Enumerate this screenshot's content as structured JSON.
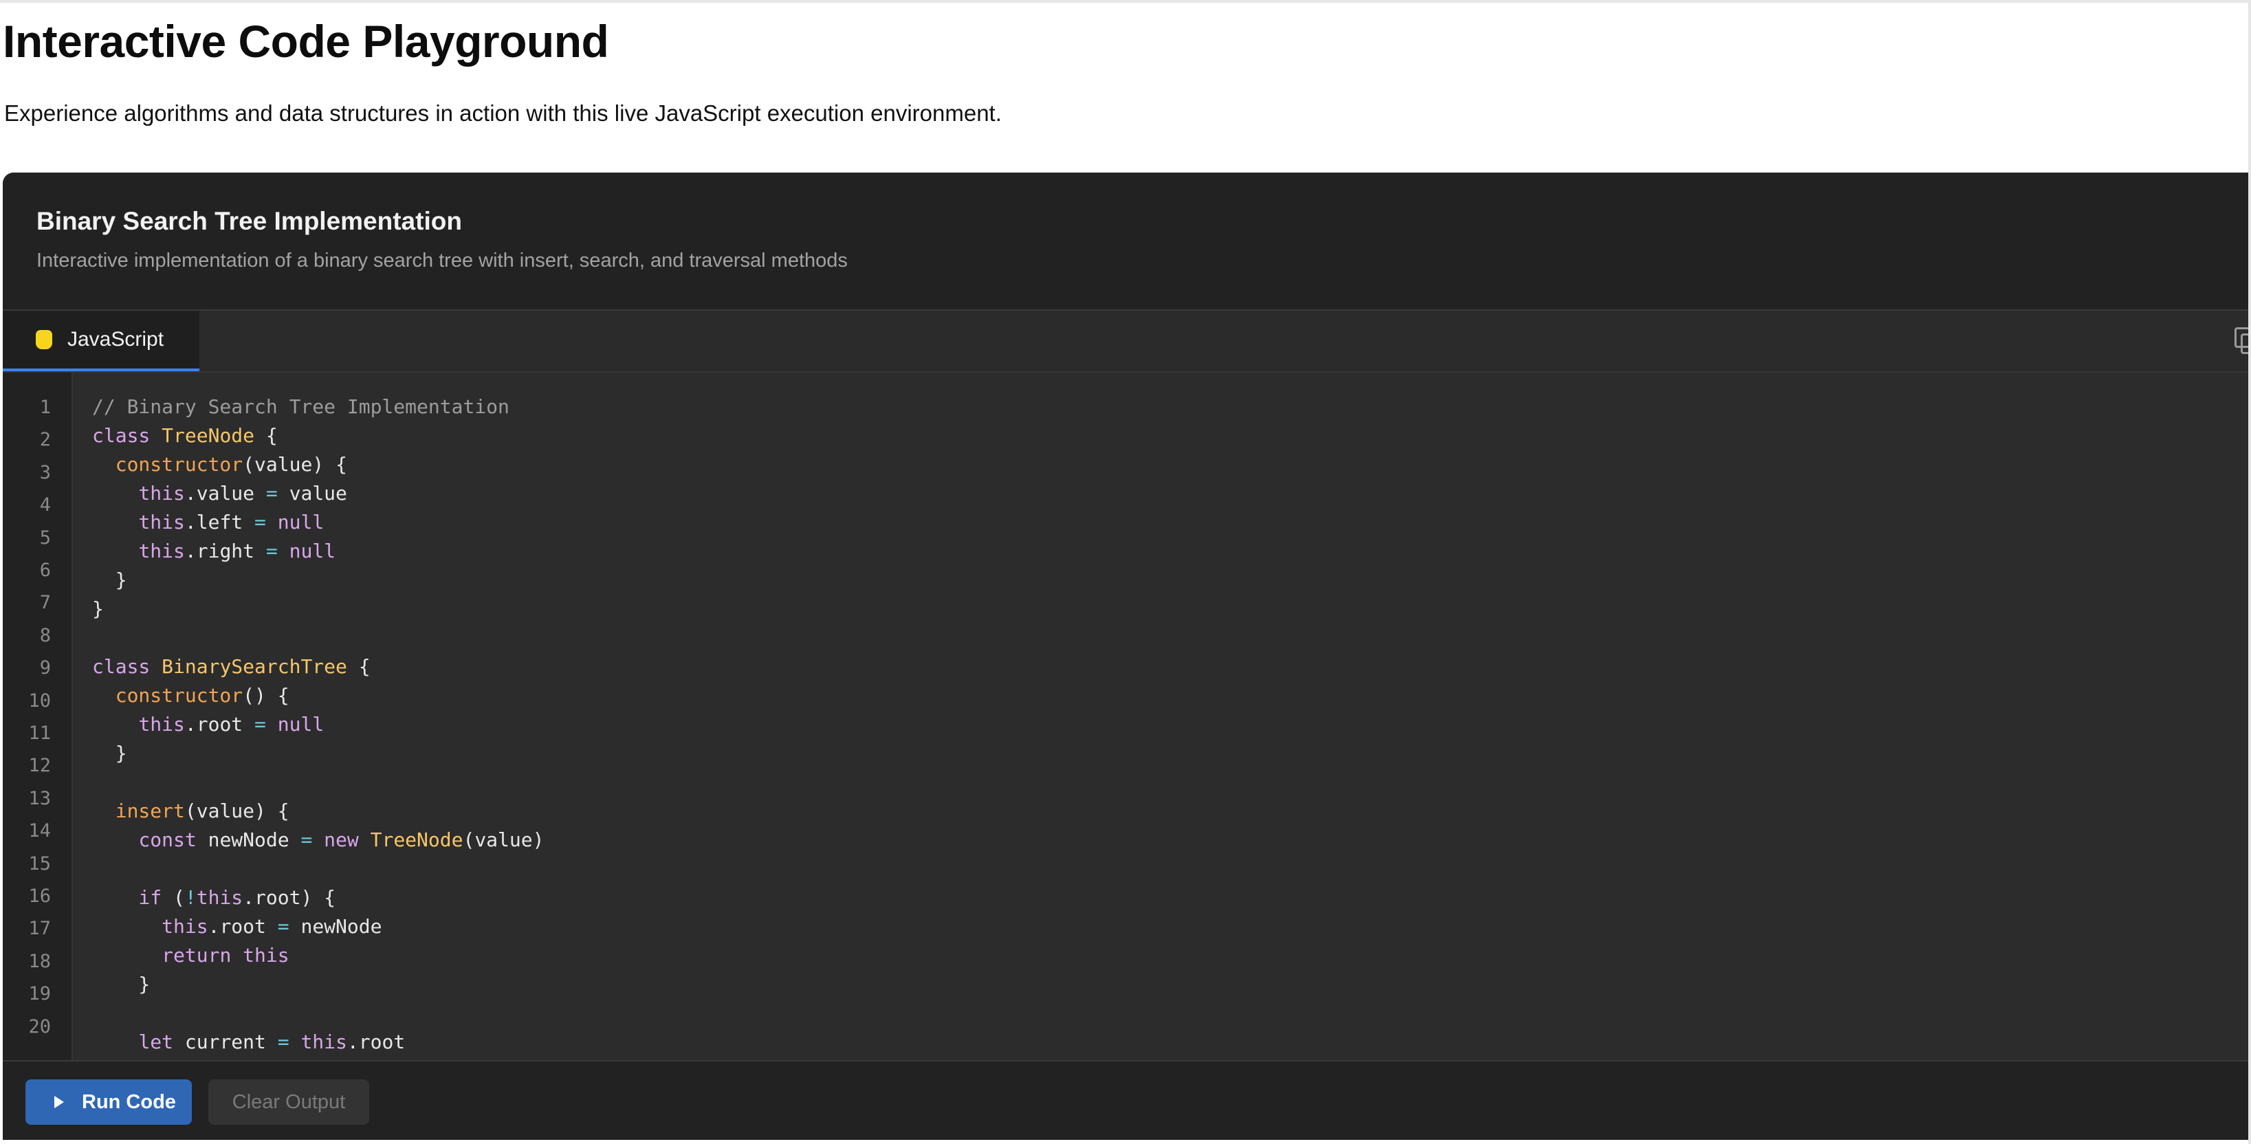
{
  "page": {
    "title": "Interactive Code Playground",
    "subtitle": "Experience algorithms and data structures in action with this live JavaScript execution environment."
  },
  "playground": {
    "title": "Binary Search Tree Implementation",
    "description": "Interactive implementation of a binary search tree with insert, search, and traversal methods",
    "tabs": [
      {
        "label": "JavaScript",
        "icon": "javascript-icon",
        "active": true
      }
    ],
    "copy_icon": "copy-icon",
    "actions": {
      "run_label": "Run Code",
      "clear_label": "Clear Output"
    }
  },
  "colors": {
    "accent": "#3b82f6",
    "run_button": "#2f67b5",
    "js_icon": "#f7d51d",
    "panel_bg": "#262626",
    "keyword": "#d8a6ea",
    "class_name": "#f6c76a",
    "function_name": "#f3a455",
    "comment": "#9c9c9c",
    "operator": "#6cc7d8"
  },
  "code": {
    "line_numbers": [
      "1",
      "2",
      "3",
      "4",
      "5",
      "6",
      "7",
      "8",
      "9",
      "10",
      "11",
      "12",
      "13",
      "14",
      "15",
      "16",
      "17",
      "18",
      "19",
      "20"
    ],
    "lines": [
      [
        {
          "t": "// Binary Search Tree Implementation",
          "c": "com"
        }
      ],
      [
        {
          "t": "class ",
          "c": "kw"
        },
        {
          "t": "TreeNode",
          "c": "cls"
        },
        {
          "t": " {",
          "c": "txt"
        }
      ],
      [
        {
          "t": "  ",
          "c": "txt"
        },
        {
          "t": "constructor",
          "c": "fn"
        },
        {
          "t": "(value) {",
          "c": "txt"
        }
      ],
      [
        {
          "t": "    ",
          "c": "txt"
        },
        {
          "t": "this",
          "c": "kw"
        },
        {
          "t": ".value ",
          "c": "txt"
        },
        {
          "t": "=",
          "c": "op"
        },
        {
          "t": " value",
          "c": "txt"
        }
      ],
      [
        {
          "t": "    ",
          "c": "txt"
        },
        {
          "t": "this",
          "c": "kw"
        },
        {
          "t": ".left ",
          "c": "txt"
        },
        {
          "t": "=",
          "c": "op"
        },
        {
          "t": " ",
          "c": "txt"
        },
        {
          "t": "null",
          "c": "nul"
        }
      ],
      [
        {
          "t": "    ",
          "c": "txt"
        },
        {
          "t": "this",
          "c": "kw"
        },
        {
          "t": ".right ",
          "c": "txt"
        },
        {
          "t": "=",
          "c": "op"
        },
        {
          "t": " ",
          "c": "txt"
        },
        {
          "t": "null",
          "c": "nul"
        }
      ],
      [
        {
          "t": "  }",
          "c": "txt"
        }
      ],
      [
        {
          "t": "}",
          "c": "txt"
        }
      ],
      [
        {
          "t": "",
          "c": "txt"
        }
      ],
      [
        {
          "t": "class ",
          "c": "kw"
        },
        {
          "t": "BinarySearchTree",
          "c": "cls"
        },
        {
          "t": " {",
          "c": "txt"
        }
      ],
      [
        {
          "t": "  ",
          "c": "txt"
        },
        {
          "t": "constructor",
          "c": "fn"
        },
        {
          "t": "() {",
          "c": "txt"
        }
      ],
      [
        {
          "t": "    ",
          "c": "txt"
        },
        {
          "t": "this",
          "c": "kw"
        },
        {
          "t": ".root ",
          "c": "txt"
        },
        {
          "t": "=",
          "c": "op"
        },
        {
          "t": " ",
          "c": "txt"
        },
        {
          "t": "null",
          "c": "nul"
        }
      ],
      [
        {
          "t": "  }",
          "c": "txt"
        }
      ],
      [
        {
          "t": "",
          "c": "txt"
        }
      ],
      [
        {
          "t": "  ",
          "c": "txt"
        },
        {
          "t": "insert",
          "c": "fn"
        },
        {
          "t": "(value) {",
          "c": "txt"
        }
      ],
      [
        {
          "t": "    ",
          "c": "txt"
        },
        {
          "t": "const",
          "c": "kw"
        },
        {
          "t": " newNode ",
          "c": "txt"
        },
        {
          "t": "=",
          "c": "op"
        },
        {
          "t": " ",
          "c": "txt"
        },
        {
          "t": "new",
          "c": "kw"
        },
        {
          "t": " ",
          "c": "txt"
        },
        {
          "t": "TreeNode",
          "c": "cls"
        },
        {
          "t": "(value)",
          "c": "txt"
        }
      ],
      [
        {
          "t": "",
          "c": "txt"
        }
      ],
      [
        {
          "t": "    ",
          "c": "txt"
        },
        {
          "t": "if",
          "c": "kw"
        },
        {
          "t": " (",
          "c": "txt"
        },
        {
          "t": "!",
          "c": "op"
        },
        {
          "t": "this",
          "c": "kw"
        },
        {
          "t": ".root) {",
          "c": "txt"
        }
      ],
      [
        {
          "t": "      ",
          "c": "txt"
        },
        {
          "t": "this",
          "c": "kw"
        },
        {
          "t": ".root ",
          "c": "txt"
        },
        {
          "t": "=",
          "c": "op"
        },
        {
          "t": " newNode",
          "c": "txt"
        }
      ],
      [
        {
          "t": "      ",
          "c": "txt"
        },
        {
          "t": "return",
          "c": "kw"
        },
        {
          "t": " ",
          "c": "txt"
        },
        {
          "t": "this",
          "c": "kw"
        }
      ],
      [
        {
          "t": "    }",
          "c": "txt"
        }
      ],
      [
        {
          "t": "",
          "c": "txt"
        }
      ],
      [
        {
          "t": "    ",
          "c": "txt"
        },
        {
          "t": "let",
          "c": "kw"
        },
        {
          "t": " current ",
          "c": "txt"
        },
        {
          "t": "=",
          "c": "op"
        },
        {
          "t": " ",
          "c": "txt"
        },
        {
          "t": "this",
          "c": "kw"
        },
        {
          "t": ".root",
          "c": "txt"
        }
      ]
    ]
  }
}
